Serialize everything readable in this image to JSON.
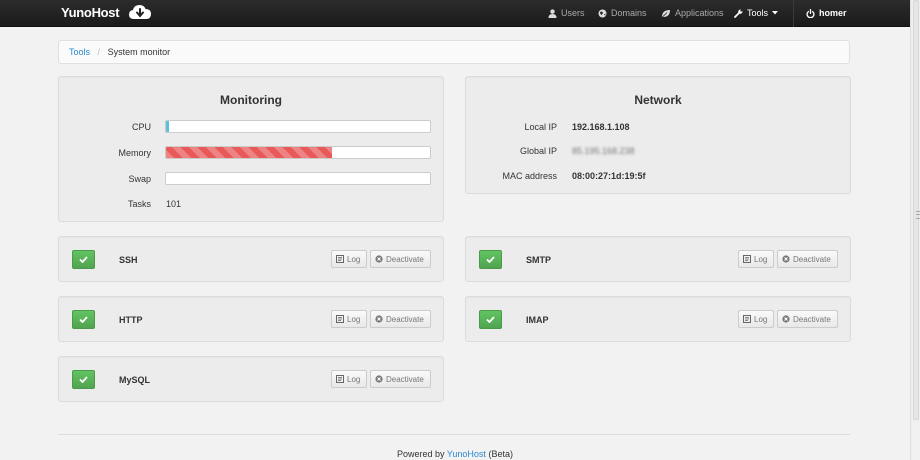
{
  "navbar": {
    "brand": "YunoHost",
    "items": [
      {
        "label": "Users",
        "icon": "user-icon"
      },
      {
        "label": "Domains",
        "icon": "globe-icon"
      },
      {
        "label": "Applications",
        "icon": "leaf-icon"
      },
      {
        "label": "Tools",
        "icon": "wrench-icon"
      }
    ],
    "user": "homer"
  },
  "breadcrumb": {
    "parent": "Tools",
    "current": "System monitor"
  },
  "monitoring": {
    "title": "Monitoring",
    "cpu_label": "CPU",
    "cpu_usage_fraction": 0.01,
    "memory_label": "Memory",
    "memory_usage_fraction": 0.63,
    "swap_label": "Swap",
    "swap_usage_fraction": 0.0,
    "tasks_label": "Tasks",
    "tasks_value": "101"
  },
  "network": {
    "title": "Network",
    "local_ip_label": "Local IP",
    "local_ip": "192.168.1.108",
    "global_ip_label": "Global IP",
    "global_ip": "85.195.168.238",
    "mac_label": "MAC address",
    "mac": "08:00:27:1d:19:5f"
  },
  "services": [
    {
      "name": "SSH",
      "log_label": "Log",
      "deactivate_label": "Deactivate",
      "status": "active"
    },
    {
      "name": "SMTP",
      "log_label": "Log",
      "deactivate_label": "Deactivate",
      "status": "active"
    },
    {
      "name": "HTTP",
      "log_label": "Log",
      "deactivate_label": "Deactivate",
      "status": "active"
    },
    {
      "name": "IMAP",
      "log_label": "Log",
      "deactivate_label": "Deactivate",
      "status": "active"
    },
    {
      "name": "MySQL",
      "log_label": "Log",
      "deactivate_label": "Deactivate",
      "status": "active"
    }
  ],
  "footer": {
    "prefix": "Powered by",
    "link": "YunoHost",
    "suffix": "(Beta)"
  },
  "colors": {
    "navbar": "#1f1f1f",
    "link": "#2a8ad0",
    "success": "#5bb75b",
    "memory_bar": "#e85a5a",
    "cpu_bar": "#5bc0de"
  }
}
